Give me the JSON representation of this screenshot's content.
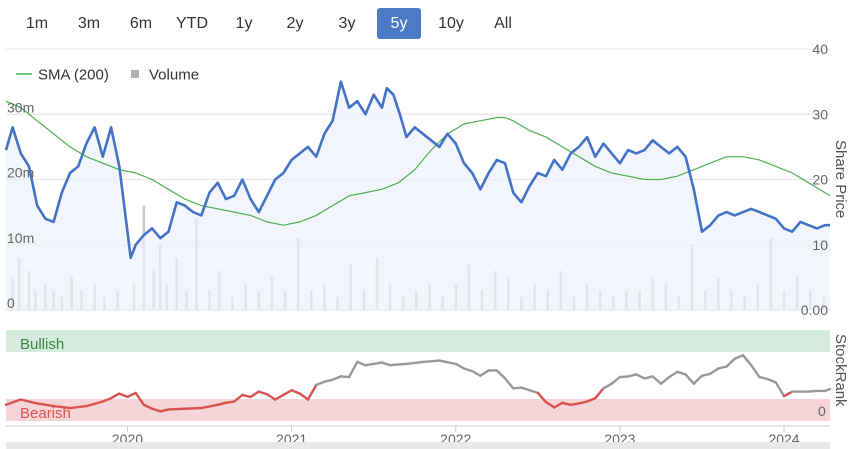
{
  "range_selector": {
    "buttons": [
      "1m",
      "3m",
      "6m",
      "YTD",
      "1y",
      "2y",
      "3y",
      "5y",
      "10y",
      "All"
    ],
    "active": "5y",
    "active_color": "#4a7bc4"
  },
  "colors": {
    "price": "#4472c4",
    "sma": "#4caf50",
    "volume": "#c8c8c8",
    "bullish_band": "#d6ebe0",
    "bearish_band": "#f6d5d8",
    "bullish_text": "#3a8a3a",
    "bearish_text": "#d9534f",
    "rank_bullish": "#999999",
    "rank_bearish": "#d9534f"
  },
  "chart_data": [
    {
      "type": "line",
      "right_axis_title": "Share Price",
      "right_axis_ticks": [
        "40",
        "30",
        "20",
        "10",
        "0.00"
      ],
      "ylim": [
        0,
        40
      ],
      "left_axis_ticks": [
        "30m",
        "20m",
        "10m",
        "0"
      ],
      "legend": [
        {
          "name": "SMA (200)",
          "icon": "line"
        },
        {
          "name": "Volume",
          "icon": "square"
        }
      ],
      "x_ticks": [
        "2020",
        "2021",
        "2022",
        "2023",
        "2024"
      ],
      "xlim": [
        2019.26,
        2024.28
      ],
      "series": [
        {
          "name": "Price",
          "x": [
            2019.26,
            2019.3,
            2019.35,
            2019.4,
            2019.45,
            2019.5,
            2019.55,
            2019.6,
            2019.65,
            2019.7,
            2019.75,
            2019.8,
            2019.85,
            2019.9,
            2019.95,
            2019.98,
            2020.02,
            2020.05,
            2020.1,
            2020.15,
            2020.2,
            2020.25,
            2020.3,
            2020.35,
            2020.4,
            2020.45,
            2020.5,
            2020.55,
            2020.6,
            2020.65,
            2020.7,
            2020.75,
            2020.8,
            2020.85,
            2020.9,
            2020.95,
            2021.0,
            2021.05,
            2021.1,
            2021.15,
            2021.2,
            2021.25,
            2021.3,
            2021.35,
            2021.4,
            2021.45,
            2021.5,
            2021.55,
            2021.58,
            2021.62,
            2021.66,
            2021.7,
            2021.75,
            2021.8,
            2021.85,
            2021.9,
            2021.95,
            2022.0,
            2022.05,
            2022.1,
            2022.15,
            2022.2,
            2022.25,
            2022.3,
            2022.35,
            2022.4,
            2022.45,
            2022.5,
            2022.55,
            2022.6,
            2022.65,
            2022.7,
            2022.75,
            2022.8,
            2022.85,
            2022.9,
            2022.95,
            2023.0,
            2023.05,
            2023.1,
            2023.15,
            2023.2,
            2023.25,
            2023.3,
            2023.35,
            2023.4,
            2023.45,
            2023.5,
            2023.55,
            2023.6,
            2023.65,
            2023.7,
            2023.75,
            2023.8,
            2023.85,
            2023.9,
            2023.95,
            2024.0,
            2024.05,
            2024.1,
            2024.15,
            2024.2,
            2024.25,
            2024.28
          ],
          "values": [
            24.5,
            28,
            24,
            22,
            16,
            14,
            13.5,
            18,
            21,
            22,
            25.5,
            28,
            23.5,
            28,
            22,
            16,
            8,
            10,
            11.5,
            12.5,
            11,
            12,
            16.5,
            16,
            15,
            14.5,
            18,
            19.5,
            17,
            17.5,
            20,
            17,
            15,
            17.5,
            20,
            21,
            23,
            24,
            25,
            23.5,
            27,
            29,
            35,
            31,
            32,
            30,
            33,
            31,
            34,
            33,
            30,
            26.5,
            28,
            27,
            26,
            25,
            27,
            25.5,
            22.5,
            21,
            18.5,
            21,
            23,
            22.5,
            18,
            16.5,
            19,
            21,
            20.5,
            23,
            21.5,
            24,
            25,
            26.5,
            23.5,
            25.5,
            24,
            22.5,
            24.5,
            24,
            24.5,
            26,
            25,
            24,
            25,
            23.5,
            18.5,
            12,
            13,
            14.5,
            15,
            14.5,
            15,
            15.5,
            15,
            14.5,
            14,
            12.5,
            12,
            13.5,
            13,
            12.5,
            13,
            13
          ]
        },
        {
          "name": "SMA (200)",
          "x": [
            2019.26,
            2019.35,
            2019.45,
            2019.55,
            2019.65,
            2019.75,
            2019.85,
            2019.95,
            2020.05,
            2020.15,
            2020.25,
            2020.35,
            2020.45,
            2020.55,
            2020.65,
            2020.75,
            2020.85,
            2020.95,
            2021.05,
            2021.15,
            2021.25,
            2021.35,
            2021.45,
            2021.55,
            2021.65,
            2021.75,
            2021.85,
            2021.95,
            2022.05,
            2022.15,
            2022.25,
            2022.3,
            2022.35,
            2022.45,
            2022.55,
            2022.65,
            2022.75,
            2022.85,
            2022.95,
            2023.05,
            2023.15,
            2023.25,
            2023.35,
            2023.45,
            2023.55,
            2023.65,
            2023.75,
            2023.85,
            2023.95,
            2024.05,
            2024.15,
            2024.28
          ],
          "values": [
            32,
            31,
            29,
            27,
            25,
            23.5,
            22.5,
            21.5,
            21,
            20,
            18.5,
            17,
            16,
            15.5,
            15,
            14.5,
            13.5,
            13,
            13.5,
            14.5,
            16,
            17.5,
            18,
            18.5,
            19.5,
            21.5,
            24.5,
            27,
            28.5,
            29,
            29.5,
            29.5,
            29,
            27.5,
            26.5,
            25,
            23.5,
            22,
            21,
            20.5,
            20,
            20,
            20.5,
            21.5,
            22.5,
            23.5,
            23.5,
            23,
            22,
            21,
            19.5,
            17.5
          ]
        }
      ],
      "volume": {
        "x": [
          2019.3,
          2019.34,
          2019.4,
          2019.44,
          2019.5,
          2019.55,
          2019.6,
          2019.66,
          2019.72,
          2019.8,
          2019.86,
          2019.94,
          2020.04,
          2020.1,
          2020.16,
          2020.2,
          2020.24,
          2020.3,
          2020.36,
          2020.42,
          2020.5,
          2020.56,
          2020.64,
          2020.72,
          2020.8,
          2020.88,
          2020.96,
          2021.04,
          2021.12,
          2021.2,
          2021.28,
          2021.36,
          2021.44,
          2021.52,
          2021.6,
          2021.68,
          2021.76,
          2021.84,
          2021.92,
          2022.0,
          2022.08,
          2022.16,
          2022.24,
          2022.32,
          2022.4,
          2022.48,
          2022.56,
          2022.64,
          2022.72,
          2022.8,
          2022.88,
          2022.96,
          2023.04,
          2023.12,
          2023.2,
          2023.28,
          2023.36,
          2023.44,
          2023.52,
          2023.6,
          2023.68,
          2023.76,
          2023.84,
          2023.92,
          2024.0,
          2024.08,
          2024.16,
          2024.24
        ],
        "values": [
          5,
          8,
          6,
          3,
          4,
          3,
          2,
          5,
          3,
          4,
          2,
          3,
          4,
          16,
          6,
          10,
          4,
          8,
          3,
          14,
          3,
          6,
          2,
          4,
          3,
          5,
          3,
          11,
          3,
          4,
          2,
          7,
          3,
          8,
          4,
          2,
          3,
          4,
          2,
          4,
          7,
          3,
          6,
          5,
          2,
          4,
          3,
          6,
          2,
          4,
          3,
          2,
          3,
          3,
          5,
          4,
          2,
          10,
          3,
          5,
          3,
          2,
          4,
          11,
          3,
          5,
          3,
          2
        ]
      }
    },
    {
      "type": "line",
      "right_axis_title": "StockRank",
      "right_axis_ticks": [
        "0"
      ],
      "bands": [
        "Bullish",
        "Bearish"
      ],
      "ylim": [
        0,
        100
      ],
      "threshold": 40,
      "series": [
        {
          "name": "StockRank",
          "x": [
            2019.26,
            2019.35,
            2019.45,
            2019.55,
            2019.65,
            2019.75,
            2019.85,
            2019.9,
            2019.95,
            2020.0,
            2020.05,
            2020.1,
            2020.15,
            2020.2,
            2020.25,
            2020.35,
            2020.45,
            2020.55,
            2020.6,
            2020.65,
            2020.7,
            2020.75,
            2020.8,
            2020.85,
            2020.9,
            2020.95,
            2021.0,
            2021.05,
            2021.1,
            2021.15,
            2021.2,
            2021.25,
            2021.3,
            2021.35,
            2021.4,
            2021.45,
            2021.55,
            2021.6,
            2021.7,
            2021.8,
            2021.9,
            2022.0,
            2022.05,
            2022.1,
            2022.15,
            2022.2,
            2022.25,
            2022.3,
            2022.35,
            2022.4,
            2022.45,
            2022.5,
            2022.55,
            2022.6,
            2022.65,
            2022.7,
            2022.75,
            2022.8,
            2022.85,
            2022.9,
            2022.95,
            2023.0,
            2023.05,
            2023.1,
            2023.15,
            2023.2,
            2023.25,
            2023.3,
            2023.35,
            2023.4,
            2023.45,
            2023.5,
            2023.55,
            2023.6,
            2023.65,
            2023.7,
            2023.75,
            2023.8,
            2023.85,
            2023.9,
            2023.95,
            2024.0,
            2024.05,
            2024.1,
            2024.15,
            2024.2,
            2024.25,
            2024.28
          ],
          "values": [
            20,
            28,
            22,
            18,
            15,
            18,
            25,
            30,
            37,
            32,
            38,
            20,
            14,
            10,
            13,
            14,
            15,
            20,
            23,
            25,
            35,
            32,
            40,
            36,
            28,
            35,
            42,
            37,
            28,
            50,
            55,
            58,
            63,
            62,
            85,
            80,
            84,
            80,
            82,
            85,
            87,
            82,
            75,
            71,
            64,
            72,
            72,
            60,
            45,
            46,
            42,
            38,
            24,
            16,
            23,
            20,
            22,
            25,
            30,
            45,
            52,
            62,
            63,
            66,
            60,
            63,
            52,
            62,
            70,
            66,
            52,
            64,
            67,
            75,
            78,
            90,
            95,
            80,
            62,
            59,
            54,
            33,
            40,
            40,
            40,
            41,
            41,
            44
          ]
        }
      ]
    }
  ]
}
